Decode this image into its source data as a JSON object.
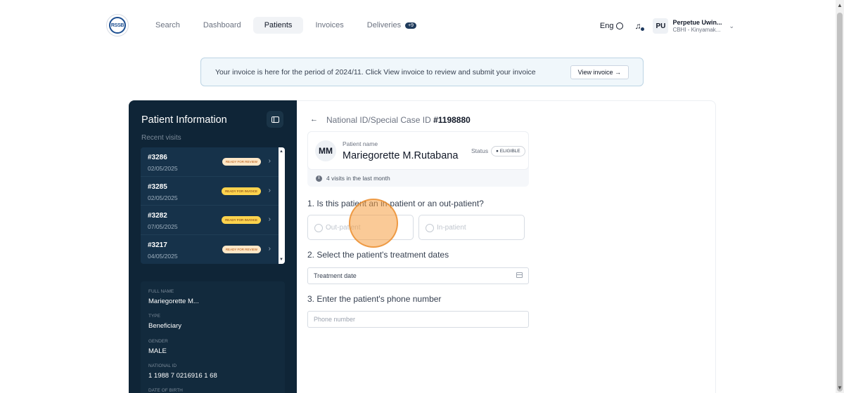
{
  "nav": {
    "logo_text": "RSSB",
    "items": [
      {
        "label": "Search"
      },
      {
        "label": "Dashboard"
      },
      {
        "label": "Patients",
        "active": true
      },
      {
        "label": "Invoices"
      },
      {
        "label": "Deliveries",
        "badge": "+9"
      }
    ],
    "language": "Eng",
    "user_initials": "PU",
    "user_name": "Perpetue Uwin...",
    "user_sub": "CBHI - Kinyamak..."
  },
  "banner": {
    "text": "Your invoice is here for the period of 2024/11. Click View invoice to review and submit your invoice",
    "button": "View invoice →"
  },
  "sidebar": {
    "title": "Patient Information",
    "recent_label": "Recent visits",
    "visits": [
      {
        "id": "#3286",
        "date": "02/05/2025",
        "status": "READY FOR REVIEW",
        "kind": "review"
      },
      {
        "id": "#3285",
        "date": "02/05/2025",
        "status": "READY FOR INVOICE",
        "kind": "invoice"
      },
      {
        "id": "#3282",
        "date": "07/05/2025",
        "status": "READY FOR INVOICE",
        "kind": "invoice"
      },
      {
        "id": "#3217",
        "date": "04/05/2025",
        "status": "READY FOR REVIEW",
        "kind": "review"
      }
    ],
    "details": [
      {
        "label": "FULL NAME",
        "value": "Mariegorette M..."
      },
      {
        "label": "TYPE",
        "value": "Beneficiary"
      },
      {
        "label": "GENDER",
        "value": "MALE"
      },
      {
        "label": "NATIONAL ID",
        "value": "1 1988 7 0216916 1 68"
      },
      {
        "label": "DATE OF BIRTH",
        "value": ""
      }
    ]
  },
  "main": {
    "crumb_prefix": "National ID/Special Case ID ",
    "crumb_id": "#1198880",
    "patient_initials": "MM",
    "patient_name_label": "Patient name",
    "patient_name": "Mariegorette M.Rutabana",
    "status_label": "Status",
    "status_value": "● ELIGIBLE",
    "visits_note": "4 visits in the last month",
    "q1": "1. Is this patient an in-patient or an out-patient?",
    "opt_out": "Out-patient",
    "opt_in": "In-patient",
    "q2": "2. Select the patient's treatment dates",
    "date_value": "Treatment date",
    "q3": "3. Enter the patient's phone number",
    "phone_placeholder": "Phone number"
  },
  "colors": {
    "sidebar_bg": "#0f2537",
    "accent": "#1f3b5c",
    "click_marker": "#f59e42"
  }
}
